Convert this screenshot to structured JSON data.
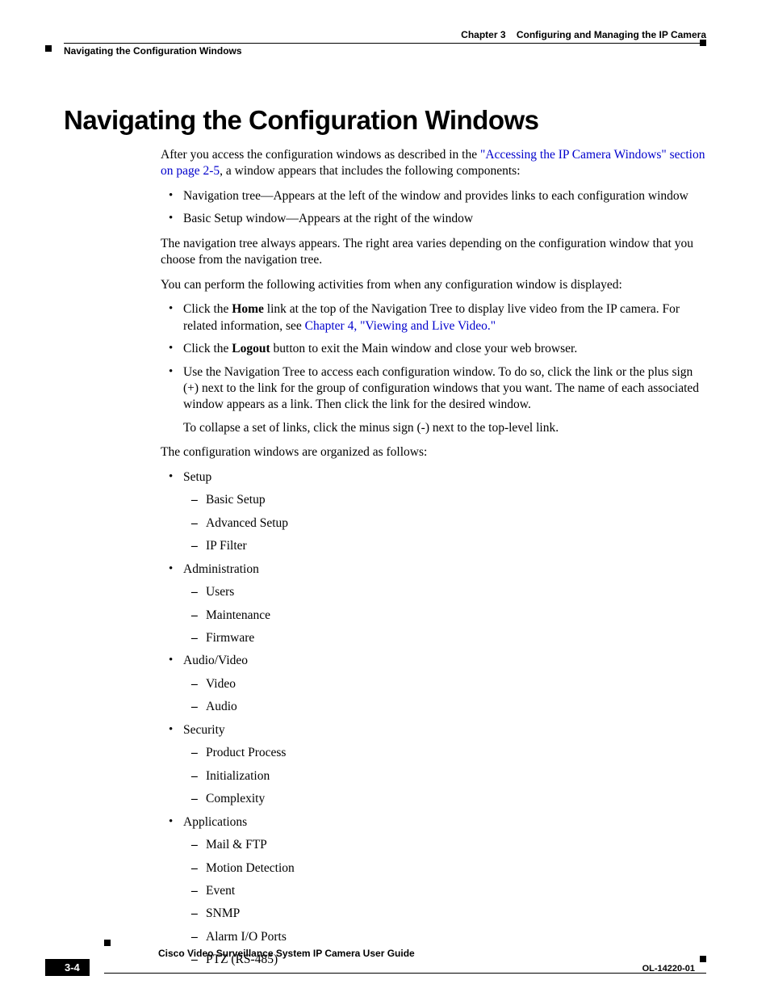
{
  "header": {
    "chapter_label": "Chapter 3",
    "chapter_title": "Configuring and Managing the IP Camera",
    "section_breadcrumb": "Navigating the Configuration Windows"
  },
  "heading": "Navigating the Configuration Windows",
  "body": {
    "p1_a": "After you access the configuration windows as described in the ",
    "p1_link": "\"Accessing the IP Camera Windows\" section on page 2-5",
    "p1_b": ", a window appears that includes the following components:",
    "list1": [
      "Navigation tree—Appears at the left of the window and provides links to each configuration window",
      "Basic Setup window—Appears at the right of the window"
    ],
    "p2": "The navigation tree always appears. The right area varies depending on the configuration window that you choose from the navigation tree.",
    "p3": "You can perform the following activities from when any configuration window is displayed:",
    "list2": {
      "item1_a": "Click the ",
      "item1_bold": "Home",
      "item1_b": " link at the top of the Navigation Tree to display live video from the IP camera. For related information, see ",
      "item1_link": "Chapter 4, \"Viewing and Live Video.\"",
      "item2_a": "Click the ",
      "item2_bold": "Logout",
      "item2_b": " button to exit the Main window and close your web browser.",
      "item3": "Use the Navigation Tree to access each configuration window. To do so, click the link or the plus sign (+) next to the link for the group of configuration windows that you want. The name of each associated window appears as a link. Then click the link for the desired window.",
      "item3_p": "To collapse a set of links, click the minus sign (-) next to the top-level link."
    },
    "p4": "The configuration windows are organized as follows:",
    "tree": [
      {
        "label": "Setup",
        "children": [
          "Basic Setup",
          "Advanced Setup",
          "IP Filter"
        ]
      },
      {
        "label": "Administration",
        "children": [
          "Users",
          "Maintenance",
          "Firmware"
        ]
      },
      {
        "label": "Audio/Video",
        "children": [
          "Video",
          "Audio"
        ]
      },
      {
        "label": "Security",
        "children": [
          "Product Process",
          "Initialization",
          "Complexity"
        ]
      },
      {
        "label": "Applications",
        "children": [
          "Mail & FTP",
          "Motion Detection",
          "Event",
          "SNMP",
          "Alarm I/O Ports",
          "PTZ (RS-485)"
        ]
      }
    ]
  },
  "footer": {
    "book_title": "Cisco Video Surveillance System IP Camera User Guide",
    "doc_number": "OL-14220-01",
    "page_number": "3-4"
  }
}
